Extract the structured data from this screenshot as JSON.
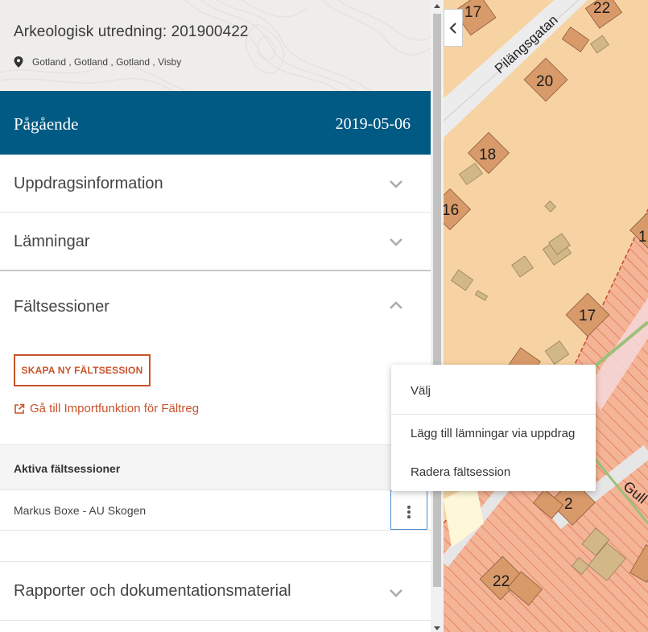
{
  "header": {
    "title": "Arkeologisk utredning: 201900422",
    "location": "Gotland , Gotland , Gotland , Visby"
  },
  "status": {
    "label": "Pågående",
    "date": "2019-05-06",
    "color": "#005a84"
  },
  "sections": {
    "uppdrag": "Uppdragsinformation",
    "lamningar": "Lämningar",
    "faltsessioner": "Fältsessioner",
    "rapporter": "Rapporter och dokumentationsmaterial"
  },
  "faltsessioner": {
    "create_button": "SKAPA NY FÄLTSESSION",
    "import_link": "Gå till Importfunktion för Fältreg",
    "active_header": "Aktiva fältsessioner",
    "sessions": [
      {
        "name": "Markus Boxe - AU Skogen"
      }
    ]
  },
  "context_menu": {
    "items": [
      "Välj",
      "Lägg till lämningar via uppdrag",
      "Radera fältsession"
    ]
  },
  "map": {
    "street_labels": [
      "Pilängsgatan",
      "Gull"
    ],
    "plot_numbers": [
      "17",
      "22",
      "20",
      "18",
      "16",
      "1",
      "17",
      "2",
      "22"
    ]
  },
  "colors": {
    "accent": "#c8532a",
    "map_background": "#f7d3a3",
    "building": "#d99a6a",
    "hatched_area": "#f2a98a"
  }
}
